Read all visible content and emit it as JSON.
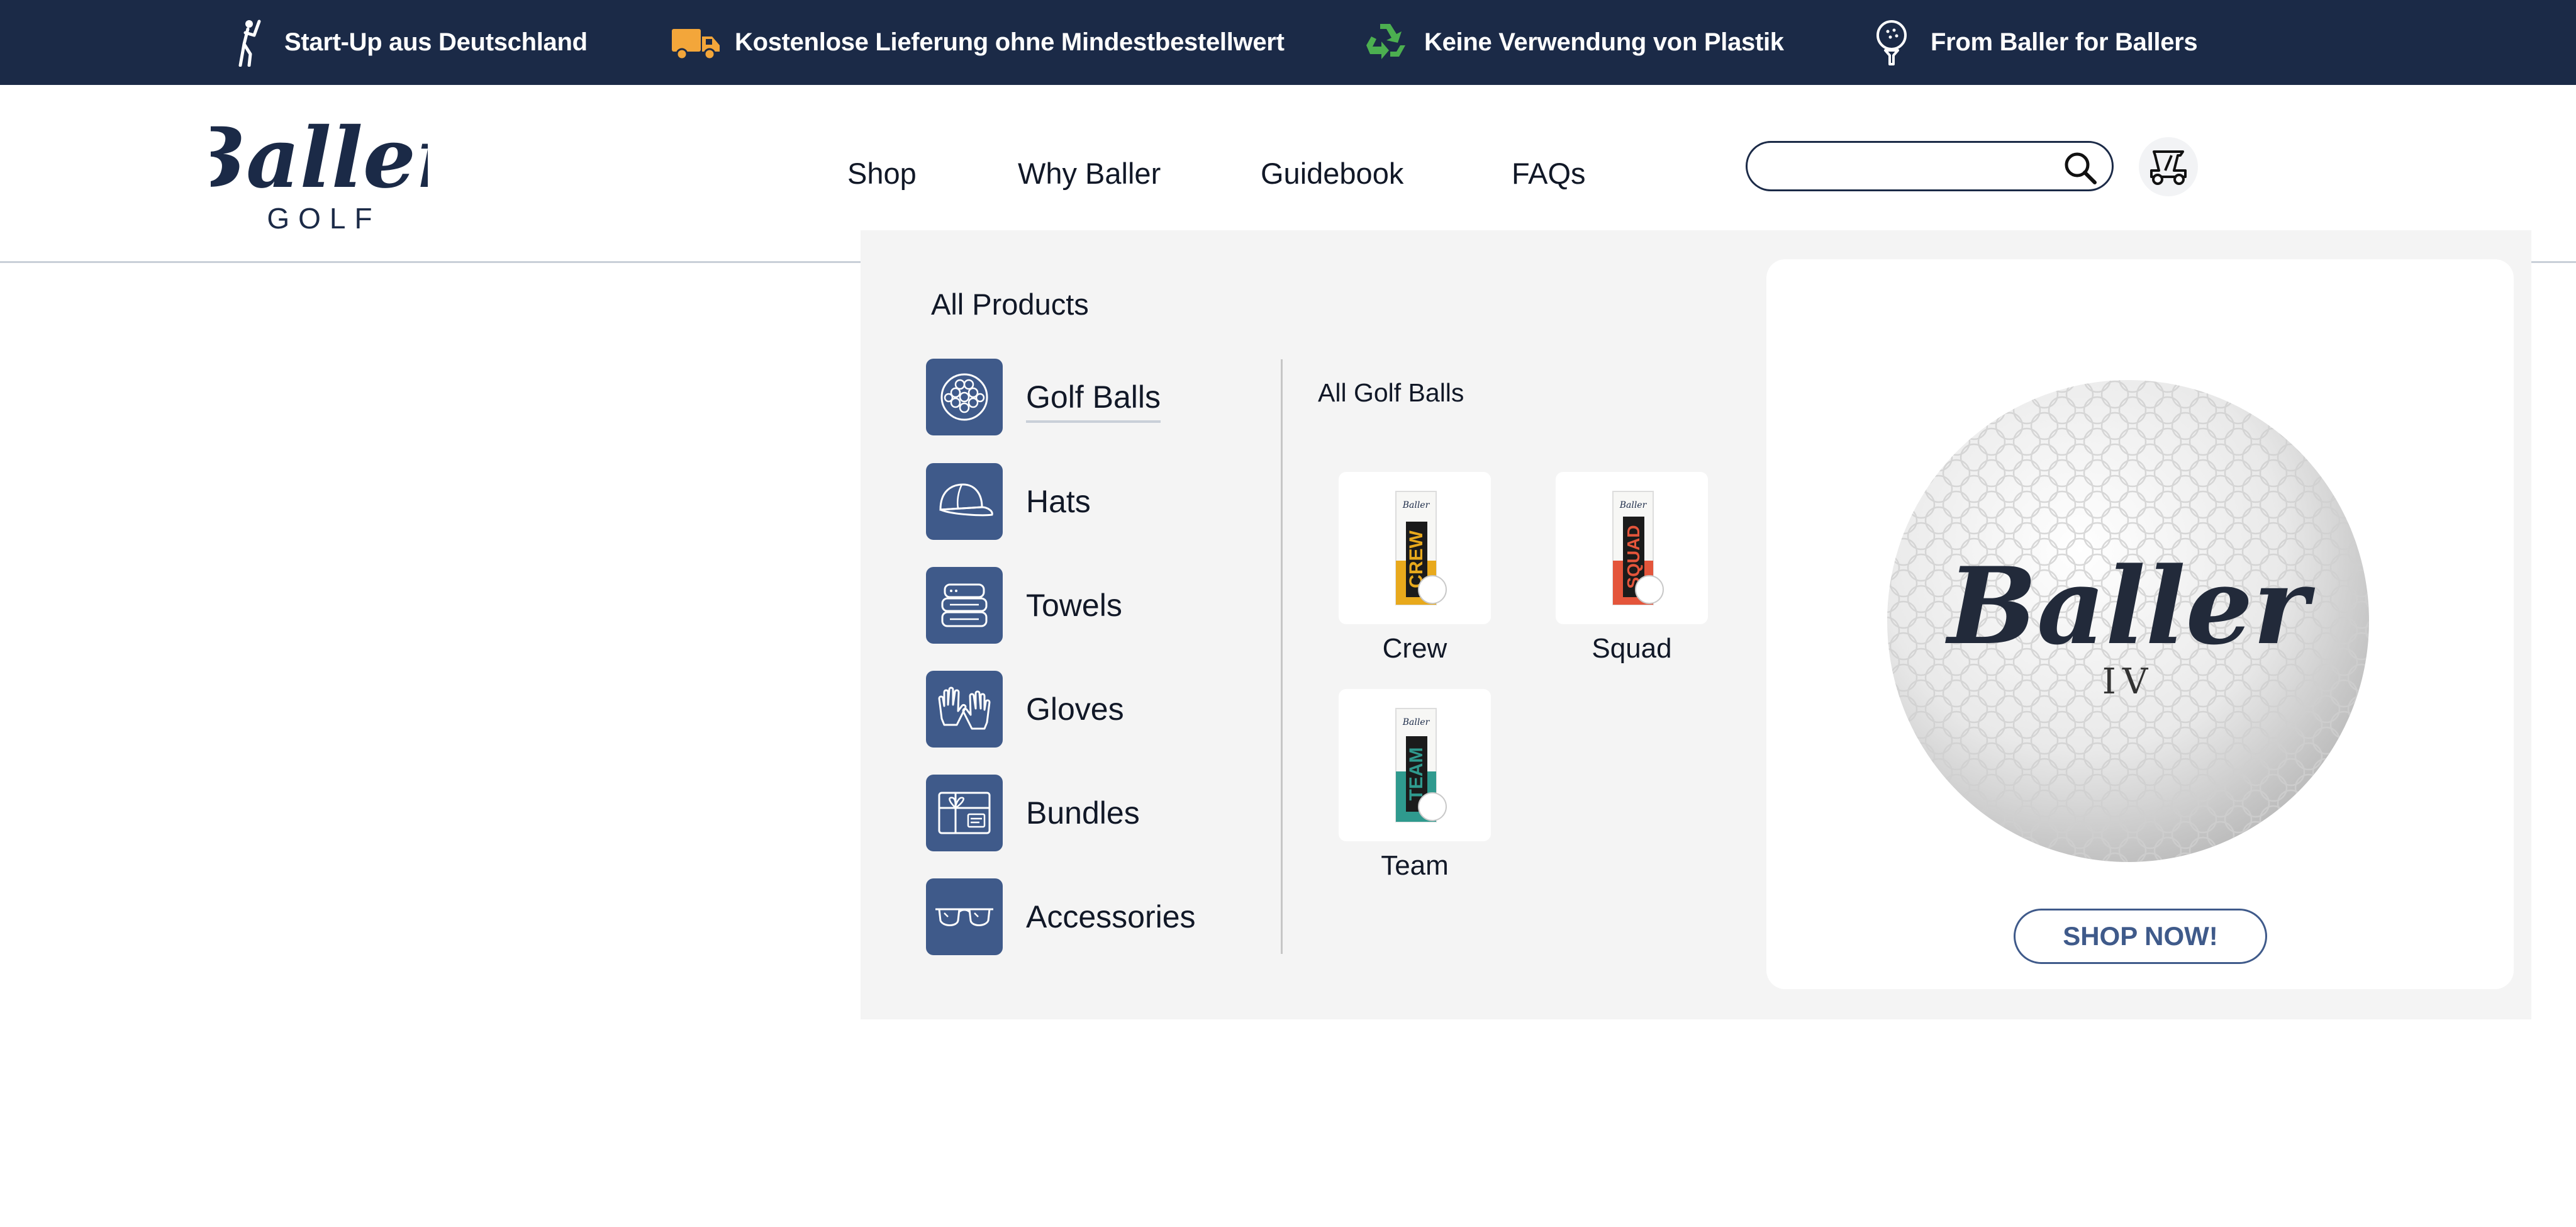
{
  "topbar": {
    "items": [
      {
        "icon": "golfer-icon",
        "text": "Start-Up aus Deutschland"
      },
      {
        "icon": "delivery-truck-icon",
        "text": "Kostenlose Lieferung ohne Mindestbestellwert"
      },
      {
        "icon": "recycle-icon",
        "text": "Keine Verwendung von Plastik"
      },
      {
        "icon": "golf-ball-on-tee-icon",
        "text": "From Baller for Ballers"
      }
    ]
  },
  "header": {
    "logo": {
      "script": "Baller",
      "sub": "GOLF"
    },
    "nav": [
      {
        "label": "Shop"
      },
      {
        "label": "Why Baller"
      },
      {
        "label": "Guidebook"
      },
      {
        "label": "FAQs"
      }
    ],
    "search": {
      "value": "",
      "placeholder": ""
    },
    "cart_icon": "golf-cart-icon"
  },
  "mega_menu": {
    "all_products": "All Products",
    "categories": [
      {
        "label": "Golf Balls",
        "icon": "golf-ball-icon",
        "active": true
      },
      {
        "label": "Hats",
        "icon": "cap-icon"
      },
      {
        "label": "Towels",
        "icon": "towel-icon"
      },
      {
        "label": "Gloves",
        "icon": "gloves-icon"
      },
      {
        "label": "Bundles",
        "icon": "gift-box-icon"
      },
      {
        "label": "Accessories",
        "icon": "sunglasses-icon"
      }
    ],
    "subcategory_title": "All Golf Balls",
    "products": [
      {
        "name": "Crew",
        "box_text": "CREW",
        "box_brand": "Baller",
        "color": "#e8a91c"
      },
      {
        "name": "Squad",
        "box_text": "SQUAD",
        "box_brand": "Baller",
        "color": "#e4553b"
      },
      {
        "name": "Team",
        "box_text": "TEAM",
        "box_brand": "Baller",
        "color": "#2f9a8e"
      }
    ],
    "feature": {
      "ball_brand": "Baller",
      "ball_model": "IV",
      "cta": "SHOP NOW!"
    }
  },
  "colors": {
    "navy": "#1b2a47",
    "tile_blue": "#3f5a8a",
    "menu_bg": "#f4f4f4",
    "truck_orange": "#f3a63a",
    "recycle_green": "#4caf50"
  }
}
